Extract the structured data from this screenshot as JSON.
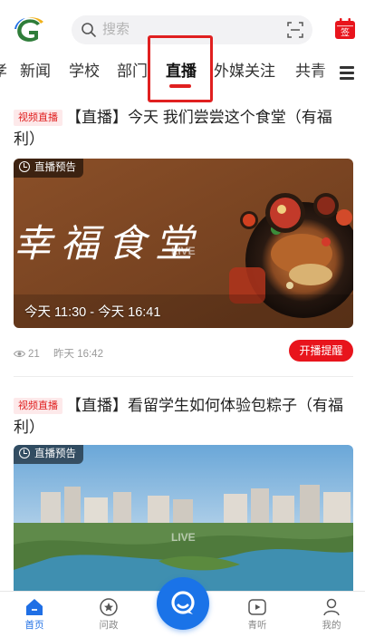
{
  "search": {
    "placeholder": "搜索"
  },
  "header": {
    "sign_label": "签"
  },
  "tabs": [
    {
      "label": "孝"
    },
    {
      "label": "新闻"
    },
    {
      "label": "学校"
    },
    {
      "label": "部门"
    },
    {
      "label": "直播"
    },
    {
      "label": "外媒关注"
    },
    {
      "label": "共青"
    }
  ],
  "feed": [
    {
      "tag": "视频直播",
      "title": "【直播】今天 我们尝尝这个食堂（有福利）",
      "badge": "直播预告",
      "poster_text": "幸福食堂",
      "live_mark": "LIVE",
      "time_range": "今天 11:30 - 今天 16:41",
      "views": "21",
      "posted": "昨天 16:42",
      "remind_label": "开播提醒"
    },
    {
      "tag": "视频直播",
      "title": "【直播】看留学生如何体验包粽子（有福利）",
      "badge": "直播预告",
      "live_mark": "LIVE"
    }
  ],
  "bottom_nav": [
    {
      "label": "首页",
      "icon": "home-icon"
    },
    {
      "label": "问政",
      "icon": "star-chat-icon"
    },
    {
      "label": "",
      "icon": "chat-bubble-icon"
    },
    {
      "label": "青听",
      "icon": "video-play-icon"
    },
    {
      "label": "我的",
      "icon": "user-icon"
    }
  ],
  "colors": {
    "accent_red": "#e02020",
    "brand_blue": "#1a73e8"
  }
}
